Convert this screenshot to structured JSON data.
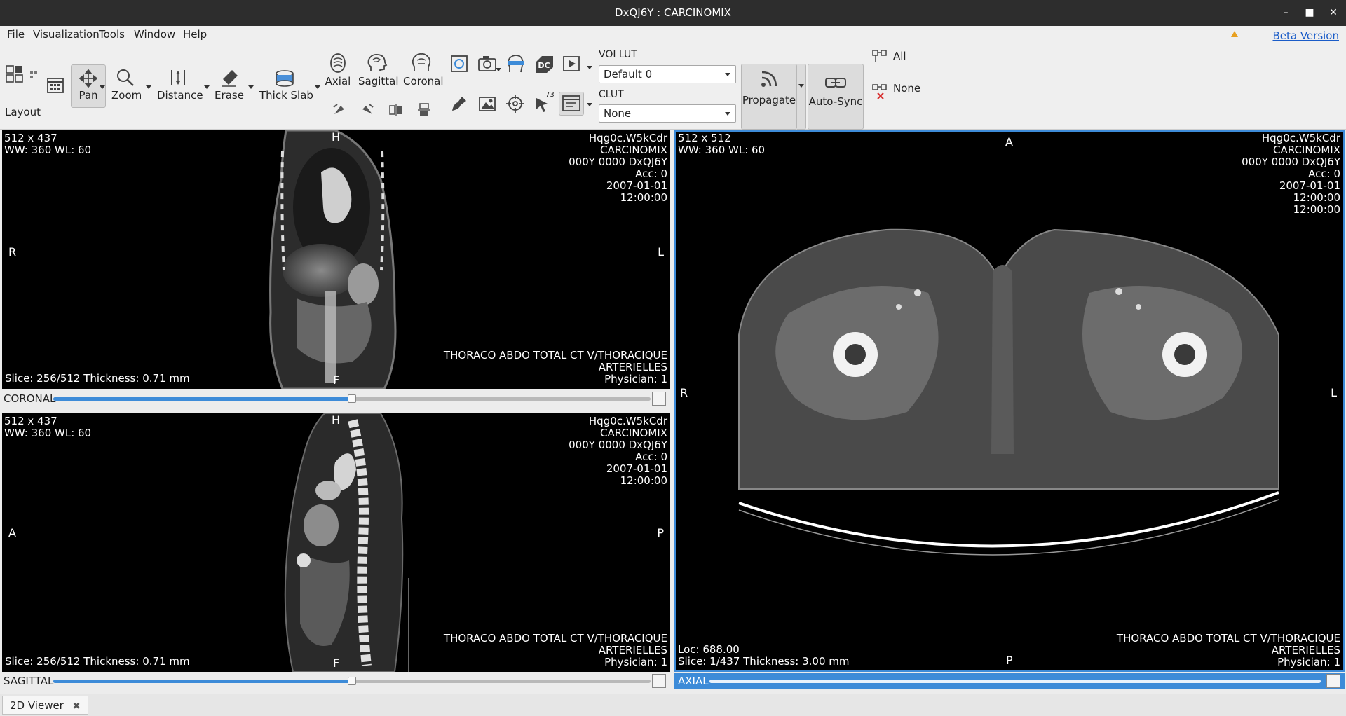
{
  "window": {
    "title": "DxQJ6Y : CARCINOMIX"
  },
  "menu": {
    "items": [
      "File",
      "Visualization",
      "Tools",
      "Window",
      "Help"
    ],
    "beta_label": "Beta Version"
  },
  "toolbar": {
    "layout_label": "Layout",
    "pan_label": "Pan",
    "zoom_label": "Zoom",
    "distance_label": "Distance",
    "erase_label": "Erase",
    "thick_slab_label": "Thick Slab",
    "axial_label": "Axial",
    "sagittal_label": "Sagittal",
    "coronal_label": "Coronal",
    "voi_lut_label": "VOI LUT",
    "voi_lut_value": "Default 0",
    "clut_label": "CLUT",
    "clut_value": "None",
    "propagate_label": "Propagate",
    "autosync_label": "Auto-Sync",
    "all_label": "All",
    "none_label": "None",
    "small_icon_badge": "73"
  },
  "viewports": {
    "coronal": {
      "dims": "512 x 437",
      "window": "WW: 360 WL: 60",
      "patient": [
        "Hqg0c.W5kCdr",
        "CARCINOMIX",
        "000Y 0000 DxQJ6Y",
        "Acc: 0",
        "2007-01-01",
        "12:00:00"
      ],
      "study": [
        "THORACO ABDO TOTAL CT V/THORACIQUE",
        "ARTERIELLES",
        "Physician: 1"
      ],
      "slice": "Slice: 256/512 Thickness: 0.71 mm",
      "orient": {
        "top": "H",
        "bottom": "F",
        "left": "R",
        "right": "L"
      },
      "bar_label": "CORONAL",
      "slider_fraction": 0.5
    },
    "sagittal": {
      "dims": "512 x 437",
      "window": "WW: 360 WL: 60",
      "patient": [
        "Hqg0c.W5kCdr",
        "CARCINOMIX",
        "000Y 0000 DxQJ6Y",
        "Acc: 0",
        "2007-01-01",
        "12:00:00"
      ],
      "study": [
        "THORACO ABDO TOTAL CT V/THORACIQUE",
        "ARTERIELLES",
        "Physician: 1"
      ],
      "slice": "Slice: 256/512 Thickness: 0.71 mm",
      "orient": {
        "top": "H",
        "bottom": "F",
        "left": "A",
        "right": "P"
      },
      "bar_label": "SAGITTAL",
      "slider_fraction": 0.5
    },
    "axial": {
      "dims": "512 x 512",
      "window": "WW: 360 WL: 60",
      "patient": [
        "Hqg0c.W5kCdr",
        "CARCINOMIX",
        "000Y 0000 DxQJ6Y",
        "Acc: 0",
        "2007-01-01",
        "12:00:00",
        "12:00:00"
      ],
      "study": [
        "THORACO ABDO TOTAL CT V/THORACIQUE",
        "ARTERIELLES",
        "Physician: 1"
      ],
      "loc": "Loc: 688.00",
      "slice": "Slice: 1/437 Thickness: 3.00 mm",
      "orient": {
        "top": "A",
        "bottom": "P",
        "left": "R",
        "right": "L"
      },
      "bar_label": "AXIAL",
      "slider_fraction": 0.0
    }
  },
  "tabs": [
    {
      "label": "2D Viewer"
    }
  ],
  "colors": {
    "accent": "#3d8bd8",
    "titlebar": "#2d2d2d",
    "link": "#1a5cc8",
    "warning": "#e8a020"
  }
}
